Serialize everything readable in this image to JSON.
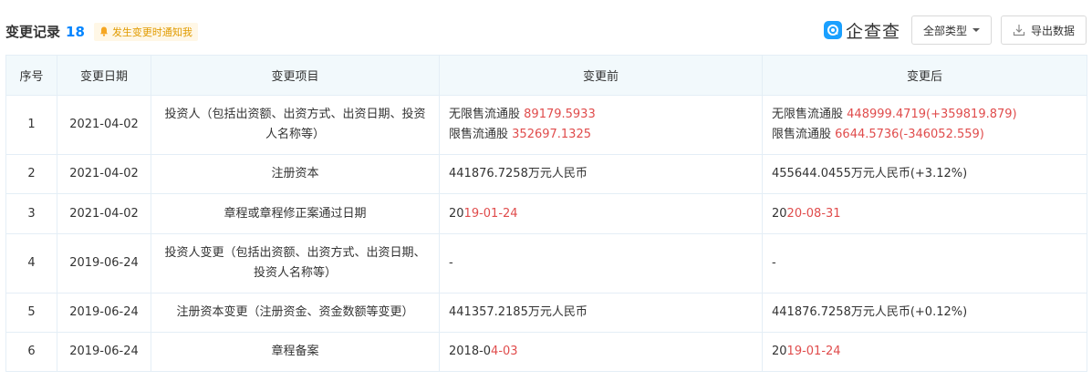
{
  "header": {
    "title": "变更记录",
    "count": "18",
    "notify_label": "发生变更时通知我",
    "logo_text": "企查查",
    "type_filter_label": "全部类型",
    "export_label": "导出数据"
  },
  "table": {
    "columns": [
      "序号",
      "变更日期",
      "变更项目",
      "变更前",
      "变更后"
    ],
    "rows": [
      {
        "no": "1",
        "date": "2021-04-02",
        "item": "投资人（包括出资额、出资方式、出资日期、投资人名称等）",
        "before_line1_label": "无限售流通股",
        "before_line1_value": "89179.5933",
        "before_line2_label": "限售流通股",
        "before_line2_value": "352697.1325",
        "after_line1_label": "无限售流通股",
        "after_line1_value": "448999.4719(+359819.879)",
        "after_line2_label": "限售流通股",
        "after_line2_value": "6644.5736(-346052.559)"
      },
      {
        "no": "2",
        "date": "2021-04-02",
        "item": "注册资本",
        "before": "441876.7258万元人民币",
        "after": "455644.0455万元人民币(+3.12%)"
      },
      {
        "no": "3",
        "date": "2021-04-02",
        "item": "章程或章程修正案通过日期",
        "before_plain": "20",
        "before_hl": "19-01-24",
        "after_plain": "20",
        "after_hl": "20-08-31"
      },
      {
        "no": "4",
        "date": "2019-06-24",
        "item": "投资人变更（包括出资额、出资方式、出资日期、投资人名称等）",
        "before": "-",
        "after": "-"
      },
      {
        "no": "5",
        "date": "2019-06-24",
        "item": "注册资本变更（注册资金、资金数额等变更）",
        "before": "441357.2185万元人民币",
        "after": "441876.7258万元人民币(+0.12%)"
      },
      {
        "no": "6",
        "date": "2019-06-24",
        "item": "章程备案",
        "before_plain": "2018-0",
        "before_hl": "4-03",
        "after_plain": "20",
        "after_hl": "19-01-24"
      }
    ]
  },
  "colors": {
    "accent_blue": "#0084ff",
    "highlight_red": "#e04c4c",
    "header_bg": "#f2f9fc",
    "notify_bg": "#fff7e6",
    "notify_text": "#e09b00"
  },
  "icons": {
    "notify": "bell-icon",
    "logo": "qcc-logo-icon",
    "dropdown": "caret-down-icon",
    "export": "download-icon"
  }
}
